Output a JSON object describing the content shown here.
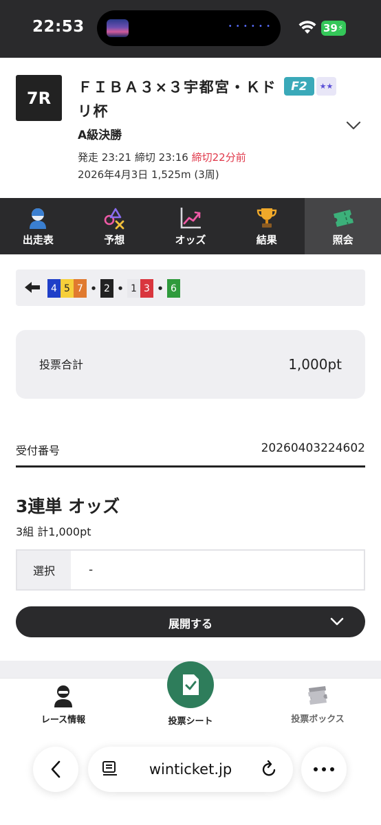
{
  "status": {
    "time": "22:53",
    "battery": "39"
  },
  "race": {
    "number": "7R",
    "title": "ＦＩＢＡ３×３宇都宮・Ｋドリ杯",
    "grade": "F2",
    "subtitle": "A級決勝",
    "start_label": "発走",
    "start_time": "23:21",
    "close_label": "締切",
    "close_time": "23:16",
    "countdown": "締切22分前",
    "date_distance": "2026年4月3日 1,525m (3周)"
  },
  "tabs": [
    {
      "label": "出走表",
      "icon": "player-icon"
    },
    {
      "label": "予想",
      "icon": "prediction-icon"
    },
    {
      "label": "オッズ",
      "icon": "odds-chart-icon"
    },
    {
      "label": "結果",
      "icon": "trophy-icon"
    },
    {
      "label": "照会",
      "icon": "ticket-icon",
      "active": true
    }
  ],
  "combination": {
    "groups": [
      [
        {
          "n": "4",
          "bg": "#1f3fc8",
          "fg": "#ffffff"
        },
        {
          "n": "5",
          "bg": "#f6cf3a",
          "fg": "#222222"
        },
        {
          "n": "7",
          "bg": "#e07a2f",
          "fg": "#ffffff"
        }
      ],
      [
        {
          "n": "2",
          "bg": "#222222",
          "fg": "#ffffff"
        }
      ],
      [
        {
          "n": "1",
          "bg": "#e8e8ec",
          "fg": "#222222"
        },
        {
          "n": "3",
          "bg": "#d9363e",
          "fg": "#ffffff"
        }
      ],
      [
        {
          "n": "6",
          "bg": "#2f9a3c",
          "fg": "#ffffff"
        }
      ]
    ],
    "separator": "•"
  },
  "summary": {
    "total_label": "投票合計",
    "total_value": "1,000pt"
  },
  "receipt": {
    "label": "受付番号",
    "value": "20260403224602"
  },
  "odds": {
    "title": "3連単 オッズ",
    "subtitle": "3組 計1,000pt",
    "select_label": "選択",
    "select_value": "-",
    "expand_label": "展開する"
  },
  "bottom_nav": {
    "race_info": "レース情報",
    "vote_sheet": "投票シート",
    "vote_box": "投票ボックス"
  },
  "browser": {
    "url": "winticket.jp"
  },
  "colors": {
    "dark": "#2a2a2c",
    "accent_green": "#2e7d5b",
    "deadline_red": "#e0384a",
    "grade_teal": "#3aa9b9"
  }
}
